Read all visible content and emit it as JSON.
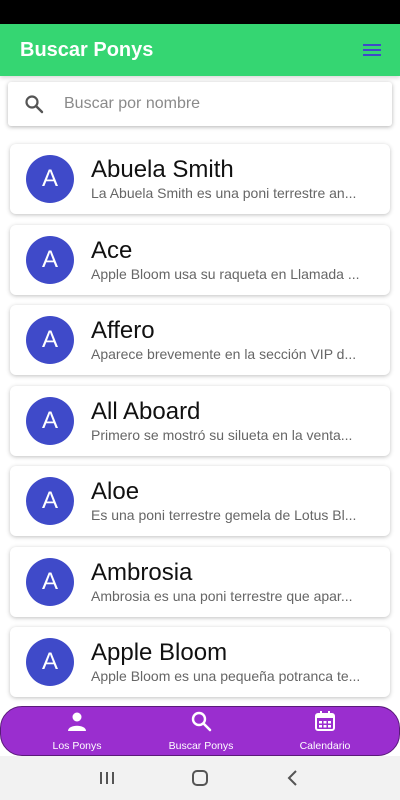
{
  "app_bar": {
    "title": "Buscar Ponys",
    "menu_icon": "hamburger-menu-icon"
  },
  "search": {
    "placeholder": "Buscar por nombre",
    "value": "",
    "icon": "search-icon"
  },
  "ponies": [
    {
      "initial": "A",
      "name": "Abuela Smith",
      "description": "La Abuela Smith es una poni terrestre an..."
    },
    {
      "initial": "A",
      "name": "Ace",
      "description": "Apple Bloom usa su raqueta en Llamada ..."
    },
    {
      "initial": "A",
      "name": "Affero",
      "description": "Aparece brevemente en la sección VIP d..."
    },
    {
      "initial": "A",
      "name": "All Aboard",
      "description": "Primero se mostró su silueta en la venta..."
    },
    {
      "initial": "A",
      "name": "Aloe",
      "description": "Es una poni terrestre gemela de Lotus Bl..."
    },
    {
      "initial": "A",
      "name": "Ambrosia",
      "description": "Ambrosia es una poni terrestre que apar..."
    },
    {
      "initial": "A",
      "name": "Apple Bloom",
      "description": "Apple Bloom es una pequeña potranca te..."
    }
  ],
  "bottom_nav": {
    "items": [
      {
        "label": "Los Ponys",
        "icon": "person-icon"
      },
      {
        "label": "Buscar Ponys",
        "icon": "search-icon"
      },
      {
        "label": "Calendario",
        "icon": "calendar-icon"
      }
    ]
  },
  "colors": {
    "app_bar": "#35d672",
    "avatar": "#3f4ac9",
    "bottom_nav": "#9a2ecf",
    "menu_icon": "#3f4ac9"
  }
}
